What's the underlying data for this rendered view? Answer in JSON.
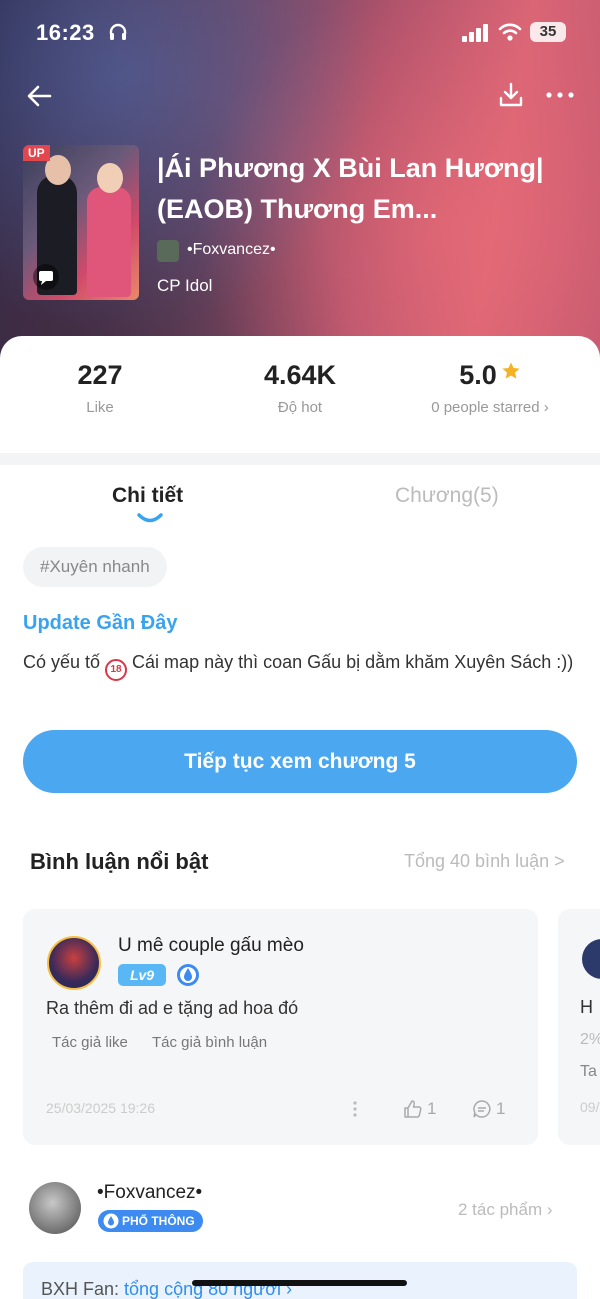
{
  "status_bar": {
    "time": "16:23",
    "battery": "35"
  },
  "book": {
    "up_badge": "UP",
    "title": "|Ái Phương X Bùi Lan Hương| (EAOB) Thương Em...",
    "author": "•Foxvancez•",
    "genre": "CP Idol"
  },
  "stats": [
    {
      "value": "227",
      "label": "Like"
    },
    {
      "value": "4.64K",
      "label": "Độ hot"
    },
    {
      "value": "5.0",
      "label": "0 people starred ›"
    }
  ],
  "tabs": {
    "detail": "Chi tiết",
    "chapters": "Chương(5)"
  },
  "tag": "#Xuyên nhanh",
  "update": {
    "title": "Update Gần Đây",
    "emoji": "18",
    "text_before": "Có yếu tố ",
    "text_after": " Cái map này thì coan Gấu bị dằm khăm Xuyên Sách :))"
  },
  "continue_button": "Tiếp tục xem chương 5",
  "comments_section": {
    "title": "Bình luận nổi bật",
    "total": "Tổng 40 bình luận >"
  },
  "comment": {
    "user": "U mê couple gấu mèo",
    "level": "Lv9",
    "text": "Ra thêm đi ad e tặng ad hoa đó",
    "tags": [
      "Tác giả like",
      "Tác giả bình luận"
    ],
    "date": "25/03/2025 19:26",
    "likes": "1",
    "replies": "1"
  },
  "comment_peek": {
    "c1": "H",
    "c2": "2%",
    "c3": "Ta",
    "c4": "09/"
  },
  "author_section": {
    "name": "•Foxvancez•",
    "badge": "PHỔ THÔNG",
    "works": "2 tác phẩm ›"
  },
  "bxh": {
    "label": "BXH Fan: ",
    "link": "tổng cộng 80 người ›"
  },
  "colors": {
    "accent": "#4aa7f0",
    "star": "#f5b324"
  }
}
